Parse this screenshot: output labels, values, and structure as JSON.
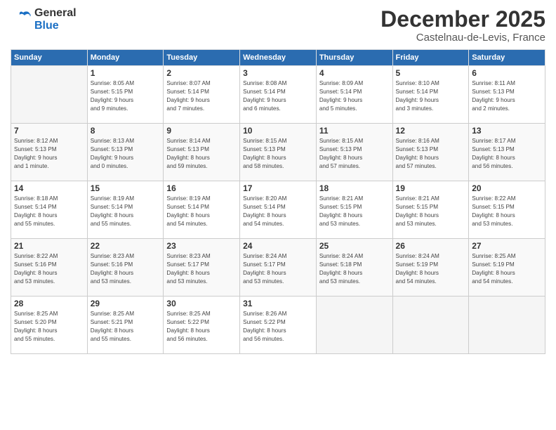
{
  "header": {
    "logo_line1": "General",
    "logo_line2": "Blue",
    "month": "December 2025",
    "location": "Castelnau-de-Levis, France"
  },
  "days_of_week": [
    "Sunday",
    "Monday",
    "Tuesday",
    "Wednesday",
    "Thursday",
    "Friday",
    "Saturday"
  ],
  "weeks": [
    [
      {
        "day": "",
        "info": ""
      },
      {
        "day": "1",
        "info": "Sunrise: 8:05 AM\nSunset: 5:15 PM\nDaylight: 9 hours\nand 9 minutes."
      },
      {
        "day": "2",
        "info": "Sunrise: 8:07 AM\nSunset: 5:14 PM\nDaylight: 9 hours\nand 7 minutes."
      },
      {
        "day": "3",
        "info": "Sunrise: 8:08 AM\nSunset: 5:14 PM\nDaylight: 9 hours\nand 6 minutes."
      },
      {
        "day": "4",
        "info": "Sunrise: 8:09 AM\nSunset: 5:14 PM\nDaylight: 9 hours\nand 5 minutes."
      },
      {
        "day": "5",
        "info": "Sunrise: 8:10 AM\nSunset: 5:14 PM\nDaylight: 9 hours\nand 3 minutes."
      },
      {
        "day": "6",
        "info": "Sunrise: 8:11 AM\nSunset: 5:13 PM\nDaylight: 9 hours\nand 2 minutes."
      }
    ],
    [
      {
        "day": "7",
        "info": "Sunrise: 8:12 AM\nSunset: 5:13 PM\nDaylight: 9 hours\nand 1 minute."
      },
      {
        "day": "8",
        "info": "Sunrise: 8:13 AM\nSunset: 5:13 PM\nDaylight: 9 hours\nand 0 minutes."
      },
      {
        "day": "9",
        "info": "Sunrise: 8:14 AM\nSunset: 5:13 PM\nDaylight: 8 hours\nand 59 minutes."
      },
      {
        "day": "10",
        "info": "Sunrise: 8:15 AM\nSunset: 5:13 PM\nDaylight: 8 hours\nand 58 minutes."
      },
      {
        "day": "11",
        "info": "Sunrise: 8:15 AM\nSunset: 5:13 PM\nDaylight: 8 hours\nand 57 minutes."
      },
      {
        "day": "12",
        "info": "Sunrise: 8:16 AM\nSunset: 5:13 PM\nDaylight: 8 hours\nand 57 minutes."
      },
      {
        "day": "13",
        "info": "Sunrise: 8:17 AM\nSunset: 5:13 PM\nDaylight: 8 hours\nand 56 minutes."
      }
    ],
    [
      {
        "day": "14",
        "info": "Sunrise: 8:18 AM\nSunset: 5:14 PM\nDaylight: 8 hours\nand 55 minutes."
      },
      {
        "day": "15",
        "info": "Sunrise: 8:19 AM\nSunset: 5:14 PM\nDaylight: 8 hours\nand 55 minutes."
      },
      {
        "day": "16",
        "info": "Sunrise: 8:19 AM\nSunset: 5:14 PM\nDaylight: 8 hours\nand 54 minutes."
      },
      {
        "day": "17",
        "info": "Sunrise: 8:20 AM\nSunset: 5:14 PM\nDaylight: 8 hours\nand 54 minutes."
      },
      {
        "day": "18",
        "info": "Sunrise: 8:21 AM\nSunset: 5:15 PM\nDaylight: 8 hours\nand 53 minutes."
      },
      {
        "day": "19",
        "info": "Sunrise: 8:21 AM\nSunset: 5:15 PM\nDaylight: 8 hours\nand 53 minutes."
      },
      {
        "day": "20",
        "info": "Sunrise: 8:22 AM\nSunset: 5:15 PM\nDaylight: 8 hours\nand 53 minutes."
      }
    ],
    [
      {
        "day": "21",
        "info": "Sunrise: 8:22 AM\nSunset: 5:16 PM\nDaylight: 8 hours\nand 53 minutes."
      },
      {
        "day": "22",
        "info": "Sunrise: 8:23 AM\nSunset: 5:16 PM\nDaylight: 8 hours\nand 53 minutes."
      },
      {
        "day": "23",
        "info": "Sunrise: 8:23 AM\nSunset: 5:17 PM\nDaylight: 8 hours\nand 53 minutes."
      },
      {
        "day": "24",
        "info": "Sunrise: 8:24 AM\nSunset: 5:17 PM\nDaylight: 8 hours\nand 53 minutes."
      },
      {
        "day": "25",
        "info": "Sunrise: 8:24 AM\nSunset: 5:18 PM\nDaylight: 8 hours\nand 53 minutes."
      },
      {
        "day": "26",
        "info": "Sunrise: 8:24 AM\nSunset: 5:19 PM\nDaylight: 8 hours\nand 54 minutes."
      },
      {
        "day": "27",
        "info": "Sunrise: 8:25 AM\nSunset: 5:19 PM\nDaylight: 8 hours\nand 54 minutes."
      }
    ],
    [
      {
        "day": "28",
        "info": "Sunrise: 8:25 AM\nSunset: 5:20 PM\nDaylight: 8 hours\nand 55 minutes."
      },
      {
        "day": "29",
        "info": "Sunrise: 8:25 AM\nSunset: 5:21 PM\nDaylight: 8 hours\nand 55 minutes."
      },
      {
        "day": "30",
        "info": "Sunrise: 8:25 AM\nSunset: 5:22 PM\nDaylight: 8 hours\nand 56 minutes."
      },
      {
        "day": "31",
        "info": "Sunrise: 8:26 AM\nSunset: 5:22 PM\nDaylight: 8 hours\nand 56 minutes."
      },
      {
        "day": "",
        "info": ""
      },
      {
        "day": "",
        "info": ""
      },
      {
        "day": "",
        "info": ""
      }
    ]
  ]
}
